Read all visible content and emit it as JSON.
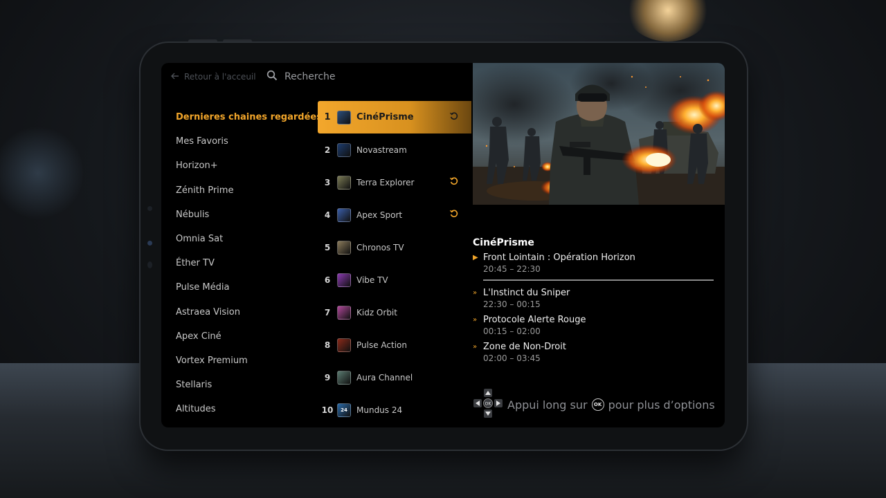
{
  "topbar": {
    "back_label": "Retour à l'acceuil",
    "search_label": "Recherche"
  },
  "categories": [
    {
      "label": "Dernieres chaines regardées",
      "active": true
    },
    {
      "label": "Mes Favoris"
    },
    {
      "label": "Horizon+"
    },
    {
      "label": "Zénith Prime"
    },
    {
      "label": "Nébulis"
    },
    {
      "label": "Omnia Sat"
    },
    {
      "label": "Éther TV"
    },
    {
      "label": "Pulse Média"
    },
    {
      "label": "Astraea Vision"
    },
    {
      "label": "Apex Ciné"
    },
    {
      "label": "Vortex Premium"
    },
    {
      "label": "Stellaris"
    },
    {
      "label": "Altitudes"
    }
  ],
  "channels": [
    {
      "num": "1",
      "name": "CinéPrisme",
      "replay": true,
      "color": "#2b4d7a"
    },
    {
      "num": "2",
      "name": "Novastream",
      "replay": false,
      "color": "#1d3c6e"
    },
    {
      "num": "3",
      "name": "Terra Explorer",
      "replay": true,
      "color": "#7a7a55"
    },
    {
      "num": "4",
      "name": "Apex Sport",
      "replay": true,
      "color": "#3a5ea8"
    },
    {
      "num": "5",
      "name": "Chronos TV",
      "replay": false,
      "color": "#8a7a5a"
    },
    {
      "num": "6",
      "name": "Vibe TV",
      "replay": false,
      "color": "#8a3ab0"
    },
    {
      "num": "7",
      "name": "Kidz Orbit",
      "replay": false,
      "color": "#b0489a"
    },
    {
      "num": "8",
      "name": "Pulse Action",
      "replay": false,
      "color": "#8a2a1a"
    },
    {
      "num": "9",
      "name": "Aura Channel",
      "replay": false,
      "color": "#5a7a70"
    },
    {
      "num": "10",
      "name": "Mundus 24",
      "replay": false,
      "color": "#2a6aa8"
    }
  ],
  "channel_logos": {
    "mundus": "24"
  },
  "epg": {
    "channel": "CinéPrisme",
    "current": {
      "title": "Front Lointain : Opération Horizon",
      "time": "20:45 – 22:30",
      "progress": 1.0
    },
    "upcoming": [
      {
        "title": "L'Instinct du Sniper",
        "time": "22:30 – 00:15"
      },
      {
        "title": "Protocole Alerte Rouge",
        "time": "00:15 – 02:00"
      },
      {
        "title": "Zone de Non-Droit",
        "time": "02:00 – 03:45"
      }
    ]
  },
  "hint": {
    "ok_label": "OK",
    "before": "Appui long sur",
    "after": "pour plus d’options"
  },
  "colors": {
    "accent": "#f1a52a",
    "screen_bg": "#000000"
  }
}
